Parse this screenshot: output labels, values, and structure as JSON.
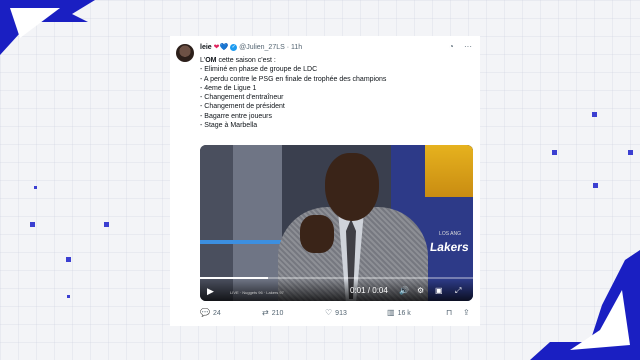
{
  "tweet": {
    "display_name": "leie",
    "heart_red": "❤",
    "heart_blue": "💙",
    "handle": "@Julien_27LS",
    "time": "11h",
    "lines": [
      {
        "lead": "L'",
        "bold": "OM",
        "rest": " cette saison c'est :"
      },
      {
        "rest": "- Eliminé en phase de groupe de LDC"
      },
      {
        "rest": "- A perdu contre le PSG en finale de trophée des champions"
      },
      {
        "rest": "- 4eme de Ligue 1"
      },
      {
        "rest": "- Changement d'entraîneur"
      },
      {
        "rest": "- Changement de président"
      },
      {
        "rest": "- Bagarre entre joueurs"
      },
      {
        "rest": "- Stage à Marbella"
      }
    ]
  },
  "video": {
    "time_current": "0:01",
    "time_total": "0:04",
    "progress": 0.25,
    "ticker": "LIVE · Nuggets 96 · Lakers 97",
    "overlay_small": "LOS ANG",
    "overlay_text": "Lakers"
  },
  "actions": {
    "replies": "24",
    "reposts": "210",
    "likes": "913",
    "views": "16 k"
  },
  "colors": {
    "accent": "#1d9bf0",
    "decor": "#1a1fc2"
  }
}
